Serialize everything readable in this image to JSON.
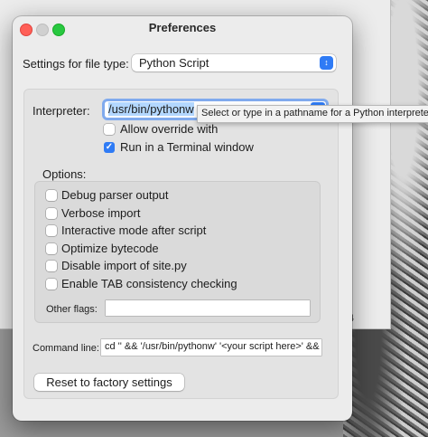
{
  "window": {
    "title": "Preferences"
  },
  "background": {
    "number_fragment": "4"
  },
  "file_type": {
    "label": "Settings for file type:",
    "selected": "Python Script"
  },
  "interpreter": {
    "label": "Interpreter:",
    "value": "/usr/bin/pythonw"
  },
  "tooltip": {
    "text": "Select or type in a pathname for a Python interpreter"
  },
  "allow_override": {
    "label": "Allow override with",
    "checked": false
  },
  "run_in_terminal": {
    "label": "Run in a Terminal window",
    "checked": true
  },
  "options": {
    "heading": "Options:",
    "items": [
      {
        "label": "Debug parser output",
        "checked": false
      },
      {
        "label": "Verbose import",
        "checked": false
      },
      {
        "label": "Interactive mode after script",
        "checked": false
      },
      {
        "label": "Optimize bytecode",
        "checked": false
      },
      {
        "label": "Disable import of site.py",
        "checked": false
      },
      {
        "label": "Enable TAB consistency checking",
        "checked": false
      }
    ],
    "other_flags_label": "Other flags:",
    "other_flags_value": ""
  },
  "command_line": {
    "label": "Command line:",
    "value": "cd '' && '/usr/bin/pythonw'  '<your script here>'  &&"
  },
  "reset_button": {
    "label": "Reset to factory settings"
  },
  "colors": {
    "accent": "#2f7bf5",
    "close": "#ff5f57",
    "zoom": "#28c840"
  }
}
